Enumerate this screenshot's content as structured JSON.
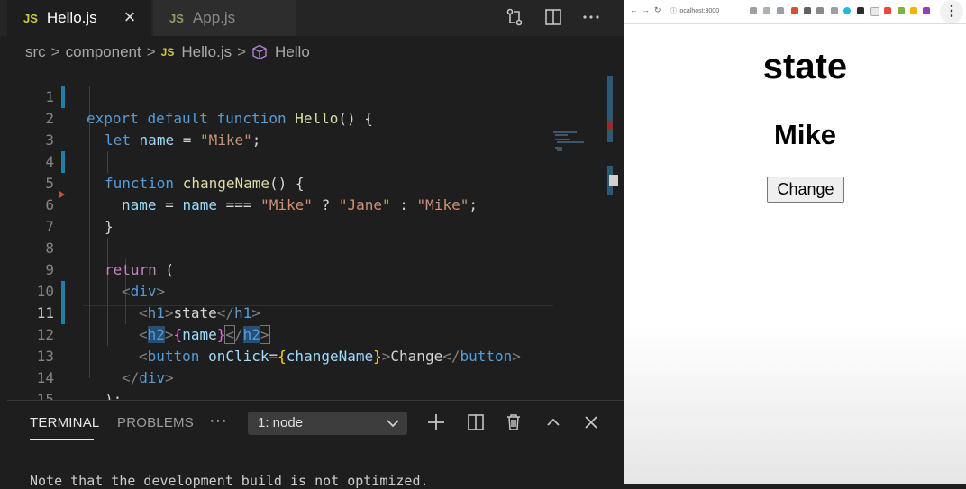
{
  "editor": {
    "tabs": [
      {
        "badge": "JS",
        "label": "Hello.js",
        "close": "×"
      },
      {
        "badge": "JS",
        "label": "App.js"
      }
    ],
    "toolbar_icons": [
      "compare-changes-icon",
      "split-editor-icon",
      "more-actions-icon"
    ],
    "breadcrumb": {
      "parts": [
        "src",
        "component"
      ],
      "file_badge": "JS",
      "file": "Hello.js",
      "symbol": "Hello",
      "separator": ">"
    },
    "line_numbers": [
      "1",
      "2",
      "3",
      "4",
      "5",
      "6",
      "7",
      "8",
      "9",
      "10",
      "11",
      "12",
      "13",
      "14",
      "15"
    ],
    "current_line": "11",
    "code": {
      "l1_kw1": "export",
      "l1_kw2": "default",
      "l1_kw3": "function",
      "l1_fn": "Hello",
      "l1_rest": "() {",
      "l2_kw": "let",
      "l2_var": "name",
      "l2_eq": " = ",
      "l2_str": "\"Mike\"",
      "l2_end": ";",
      "l4_kw": "function",
      "l4_fn": "changeName",
      "l4_rest": "() {",
      "l5_var1": "name",
      "l5_eq": " = ",
      "l5_var2": "name",
      "l5_op": " === ",
      "l5_str1": "\"Mike\"",
      "l5_q": " ? ",
      "l5_str2": "\"Jane\"",
      "l5_c": " : ",
      "l5_str3": "\"Mike\"",
      "l5_end": ";",
      "l6": "}",
      "l8_kw": "return",
      "l8_rest": " (",
      "l9_open": "<",
      "l9_tag": "div",
      "l9_close": ">",
      "l10_tag": "h1",
      "l10_text": "state",
      "l11_tag": "h2",
      "l11_expr_open": "{",
      "l11_var": "name",
      "l11_expr_close": "}",
      "l12_tag": "button",
      "l12_attr": "onClick",
      "l12_eq": "=",
      "l12_fn": "changeName",
      "l12_text": "Change",
      "l13_tag": "div",
      "l14": ");",
      "l15": "}"
    }
  },
  "panel": {
    "tabs": [
      "TERMINAL",
      "PROBLEMS"
    ],
    "more": "···",
    "terminal_select": "1: node",
    "icons": [
      "add-terminal-icon",
      "split-terminal-icon",
      "trash-icon",
      "maximize-panel-icon",
      "close-panel-icon"
    ],
    "output": "Note that the development build is not optimized."
  },
  "browser": {
    "url": "localhost:3000",
    "heading1": "state",
    "heading2": "Mike",
    "button_label": "Change",
    "menu": "⋮"
  }
}
